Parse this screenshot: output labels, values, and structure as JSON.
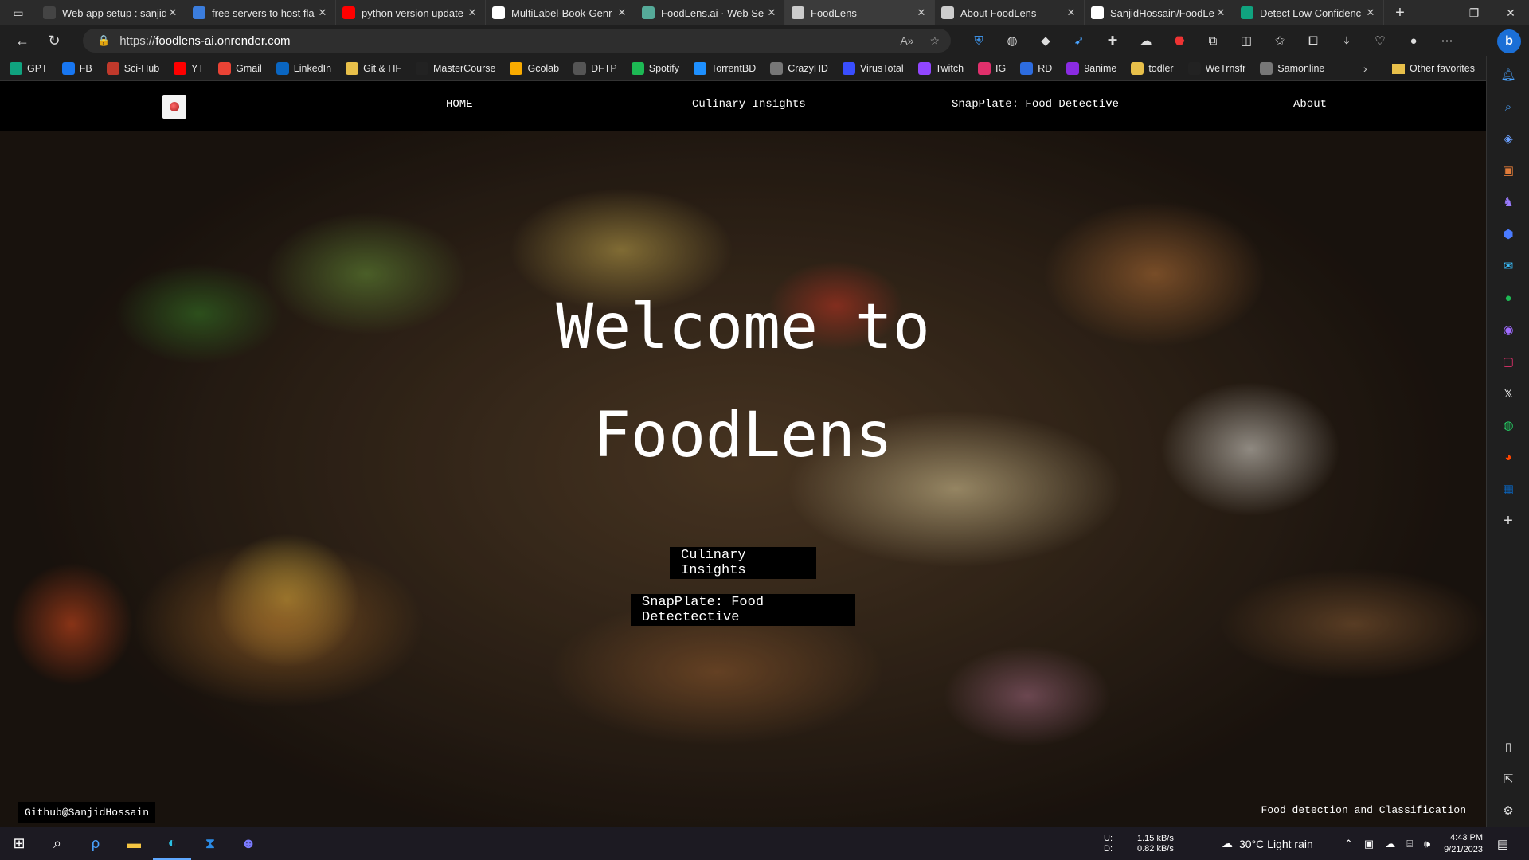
{
  "browser": {
    "tabs": [
      {
        "label": "Web app setup : sanjid",
        "icon_color": "#444444",
        "icon": "openai-icon"
      },
      {
        "label": "free servers to host fla",
        "icon_color": "#3b7ddd",
        "icon": "search-icon"
      },
      {
        "label": "python version update",
        "icon_color": "#ff0000",
        "icon": "youtube-icon"
      },
      {
        "label": "MultiLabel-Book-Genr",
        "icon_color": "#ffffff",
        "icon": "github-icon"
      },
      {
        "label": "FoodLens.ai · Web Se",
        "icon_color": "#5a9",
        "icon": "render-icon"
      },
      {
        "label": "FoodLens",
        "icon_color": "#cccccc",
        "icon": "page-icon",
        "active": true
      },
      {
        "label": "About FoodLens",
        "icon_color": "#cccccc",
        "icon": "page-icon"
      },
      {
        "label": "SanjidHossain/FoodLe",
        "icon_color": "#ffffff",
        "icon": "github-icon"
      },
      {
        "label": "Detect Low Confidenc",
        "icon_color": "#10a37f",
        "icon": "chatgpt-icon"
      }
    ],
    "new_tab": "+",
    "url_prefix": "https://",
    "url_host": "foodlens-ai.onrender.com",
    "bookmarks": [
      {
        "label": "GPT",
        "color": "#10a37f"
      },
      {
        "label": "FB",
        "color": "#1877f2"
      },
      {
        "label": "Sci-Hub",
        "color": "#c0392b"
      },
      {
        "label": "YT",
        "color": "#ff0000"
      },
      {
        "label": "Gmail",
        "color": "#ea4335"
      },
      {
        "label": "LinkedIn",
        "color": "#0a66c2"
      },
      {
        "label": "Git & HF",
        "color": "#e8c04a"
      },
      {
        "label": "MasterCourse",
        "color": "#222222"
      },
      {
        "label": "Gcolab",
        "color": "#f9ab00"
      },
      {
        "label": "DFTP",
        "color": "#555555"
      },
      {
        "label": "Spotify",
        "color": "#1db954"
      },
      {
        "label": "TorrentBD",
        "color": "#1e90ff"
      },
      {
        "label": "CrazyHD",
        "color": "#777777"
      },
      {
        "label": "VirusTotal",
        "color": "#394eff"
      },
      {
        "label": "Twitch",
        "color": "#9146ff"
      },
      {
        "label": "IG",
        "color": "#e1306c"
      },
      {
        "label": "RD",
        "color": "#2d6cdf"
      },
      {
        "label": "9anime",
        "color": "#8a2be2"
      },
      {
        "label": "todler",
        "color": "#e8c04a"
      },
      {
        "label": "WeTrnsfr",
        "color": "#222222"
      },
      {
        "label": "Samonline",
        "color": "#777777"
      }
    ],
    "other_favorites": "Other favorites"
  },
  "site": {
    "nav": {
      "home": "HOME",
      "culinary": "Culinary Insights",
      "snapplate": "SnapPlate: Food Detective",
      "about": "About"
    },
    "hero": {
      "line1": "Welcome to",
      "line2": "FoodLens",
      "btn_culinary": "Culinary Insights",
      "btn_snapplate": "SnapPlate: Food Detectective"
    },
    "footer_left": "Github@SanjidHossain",
    "footer_right": "Food detection and Classification"
  },
  "taskbar": {
    "net_up_label": "U:",
    "net_down_label": "D:",
    "net_up": "1.15 kB/s",
    "net_down": "0.82 kB/s",
    "weather": "30°C  Light rain",
    "time": "4:43 PM",
    "date": "9/21/2023"
  }
}
